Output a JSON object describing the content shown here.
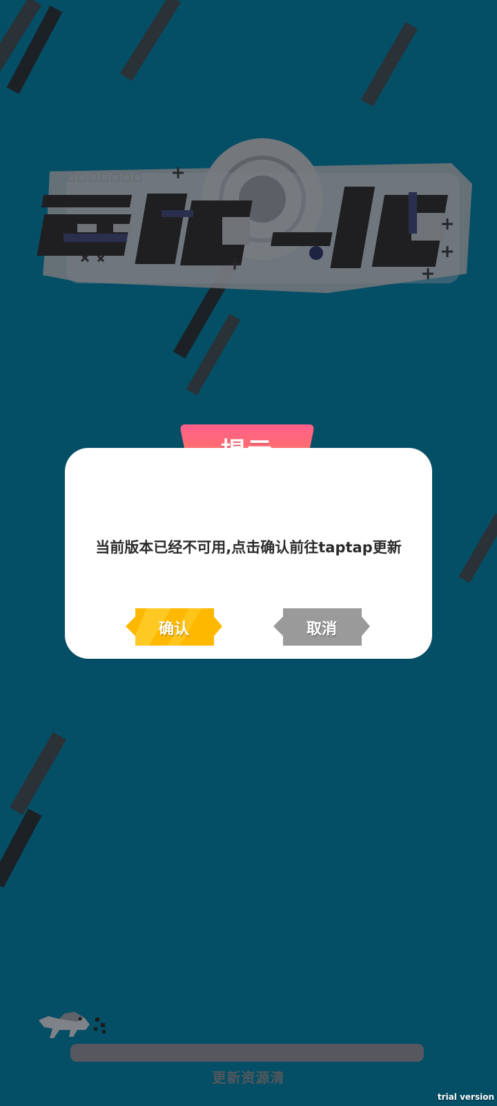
{
  "dialog": {
    "title": "提示",
    "message": "当前版本已经不可用,点击确认前往taptap更新",
    "confirm_label": "确认",
    "cancel_label": "取消"
  },
  "loading": {
    "status_text": "更新资源清",
    "progress_percent": 0
  },
  "watermark": "trial version",
  "logo": {
    "name": "再切一把",
    "icon_name": "game-logo"
  },
  "colors": {
    "background": "#044e66",
    "tab_gradient_start": "#ff5f8b",
    "tab_gradient_end": "#ff7a55",
    "confirm_button": "#ffb800",
    "cancel_button": "#9a9a9a",
    "progress_track": "#56575f"
  }
}
